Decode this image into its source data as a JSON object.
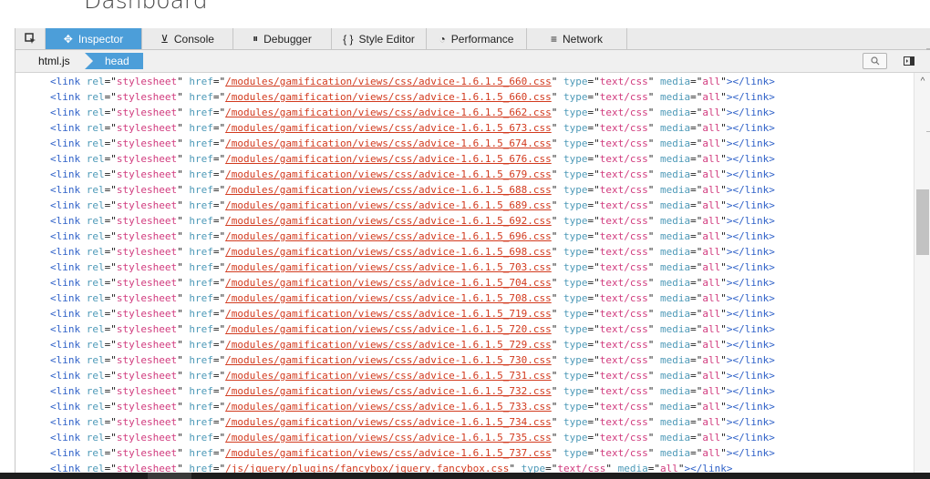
{
  "page": {
    "title": "Dashboard"
  },
  "toolbar": {
    "picker_icon": "element-picker-icon",
    "tabs": [
      {
        "label": "Inspector",
        "icon": "gear-icon",
        "glyph": "✥",
        "active": true
      },
      {
        "label": "Console",
        "icon": "console-icon",
        "glyph": "⊻",
        "active": false
      },
      {
        "label": "Debugger",
        "icon": "pause-icon",
        "glyph": "⏸",
        "active": false
      },
      {
        "label": "Style Editor",
        "icon": "braces-icon",
        "glyph": "{ }",
        "active": false
      },
      {
        "label": "Performance",
        "icon": "stopwatch-icon",
        "glyph": "◔",
        "active": false
      },
      {
        "label": "Network",
        "icon": "network-icon",
        "glyph": "≡",
        "active": false
      }
    ]
  },
  "breadcrumbs": [
    {
      "label": "html.js",
      "selected": false
    },
    {
      "label": "head",
      "selected": true
    }
  ],
  "colors": {
    "accent": "#4c9ed9",
    "tag": "#2f61c8",
    "attribute": "#4e9ab8",
    "value": "#d13b7e",
    "link": "#d23a1e"
  },
  "markup": {
    "lines": [
      {
        "tag": "link",
        "rel": "stylesheet",
        "href": "/modules/gamification/views/css/advice-1.6.1.5_660.css",
        "type": "text/css",
        "media": "all"
      },
      {
        "tag": "link",
        "rel": "stylesheet",
        "href": "/modules/gamification/views/css/advice-1.6.1.5_660.css",
        "type": "text/css",
        "media": "all"
      },
      {
        "tag": "link",
        "rel": "stylesheet",
        "href": "/modules/gamification/views/css/advice-1.6.1.5_662.css",
        "type": "text/css",
        "media": "all"
      },
      {
        "tag": "link",
        "rel": "stylesheet",
        "href": "/modules/gamification/views/css/advice-1.6.1.5_673.css",
        "type": "text/css",
        "media": "all"
      },
      {
        "tag": "link",
        "rel": "stylesheet",
        "href": "/modules/gamification/views/css/advice-1.6.1.5_674.css",
        "type": "text/css",
        "media": "all"
      },
      {
        "tag": "link",
        "rel": "stylesheet",
        "href": "/modules/gamification/views/css/advice-1.6.1.5_676.css",
        "type": "text/css",
        "media": "all"
      },
      {
        "tag": "link",
        "rel": "stylesheet",
        "href": "/modules/gamification/views/css/advice-1.6.1.5_679.css",
        "type": "text/css",
        "media": "all"
      },
      {
        "tag": "link",
        "rel": "stylesheet",
        "href": "/modules/gamification/views/css/advice-1.6.1.5_688.css",
        "type": "text/css",
        "media": "all"
      },
      {
        "tag": "link",
        "rel": "stylesheet",
        "href": "/modules/gamification/views/css/advice-1.6.1.5_689.css",
        "type": "text/css",
        "media": "all"
      },
      {
        "tag": "link",
        "rel": "stylesheet",
        "href": "/modules/gamification/views/css/advice-1.6.1.5_692.css",
        "type": "text/css",
        "media": "all"
      },
      {
        "tag": "link",
        "rel": "stylesheet",
        "href": "/modules/gamification/views/css/advice-1.6.1.5_696.css",
        "type": "text/css",
        "media": "all"
      },
      {
        "tag": "link",
        "rel": "stylesheet",
        "href": "/modules/gamification/views/css/advice-1.6.1.5_698.css",
        "type": "text/css",
        "media": "all"
      },
      {
        "tag": "link",
        "rel": "stylesheet",
        "href": "/modules/gamification/views/css/advice-1.6.1.5_703.css",
        "type": "text/css",
        "media": "all"
      },
      {
        "tag": "link",
        "rel": "stylesheet",
        "href": "/modules/gamification/views/css/advice-1.6.1.5_704.css",
        "type": "text/css",
        "media": "all"
      },
      {
        "tag": "link",
        "rel": "stylesheet",
        "href": "/modules/gamification/views/css/advice-1.6.1.5_708.css",
        "type": "text/css",
        "media": "all"
      },
      {
        "tag": "link",
        "rel": "stylesheet",
        "href": "/modules/gamification/views/css/advice-1.6.1.5_719.css",
        "type": "text/css",
        "media": "all"
      },
      {
        "tag": "link",
        "rel": "stylesheet",
        "href": "/modules/gamification/views/css/advice-1.6.1.5_720.css",
        "type": "text/css",
        "media": "all"
      },
      {
        "tag": "link",
        "rel": "stylesheet",
        "href": "/modules/gamification/views/css/advice-1.6.1.5_729.css",
        "type": "text/css",
        "media": "all"
      },
      {
        "tag": "link",
        "rel": "stylesheet",
        "href": "/modules/gamification/views/css/advice-1.6.1.5_730.css",
        "type": "text/css",
        "media": "all"
      },
      {
        "tag": "link",
        "rel": "stylesheet",
        "href": "/modules/gamification/views/css/advice-1.6.1.5_731.css",
        "type": "text/css",
        "media": "all"
      },
      {
        "tag": "link",
        "rel": "stylesheet",
        "href": "/modules/gamification/views/css/advice-1.6.1.5_732.css",
        "type": "text/css",
        "media": "all"
      },
      {
        "tag": "link",
        "rel": "stylesheet",
        "href": "/modules/gamification/views/css/advice-1.6.1.5_733.css",
        "type": "text/css",
        "media": "all"
      },
      {
        "tag": "link",
        "rel": "stylesheet",
        "href": "/modules/gamification/views/css/advice-1.6.1.5_734.css",
        "type": "text/css",
        "media": "all"
      },
      {
        "tag": "link",
        "rel": "stylesheet",
        "href": "/modules/gamification/views/css/advice-1.6.1.5_735.css",
        "type": "text/css",
        "media": "all"
      },
      {
        "tag": "link",
        "rel": "stylesheet",
        "href": "/modules/gamification/views/css/advice-1.6.1.5_737.css",
        "type": "text/css",
        "media": "all"
      },
      {
        "tag": "link",
        "rel": "stylesheet",
        "href": "/js/jquery/plugins/fancybox/jquery.fancybox.css",
        "type": "text/css",
        "media": "all"
      }
    ]
  }
}
